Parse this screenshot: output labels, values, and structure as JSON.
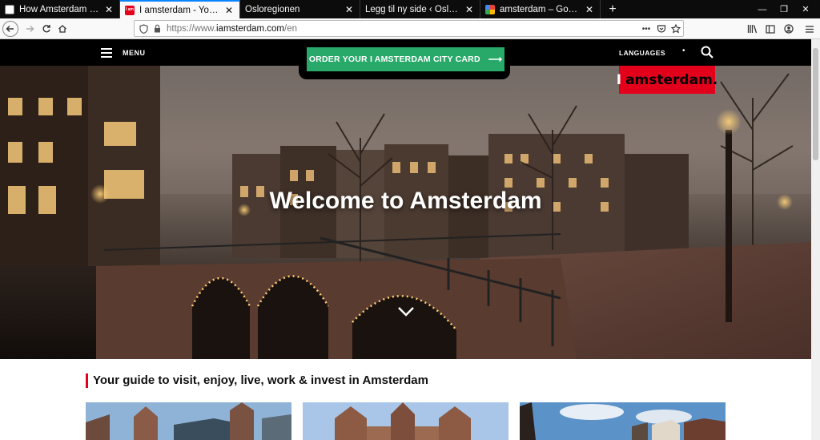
{
  "browser": {
    "tabs": [
      {
        "title": "How Amsterdam is fighting m"
      },
      {
        "title": "I amsterdam - Your guide to vis"
      },
      {
        "title": "Osloregionen"
      },
      {
        "title": "Legg til ny side ‹ Osloregionen — W"
      },
      {
        "title": "amsterdam – Google Søk"
      }
    ],
    "new_tab_symbol": "+",
    "close_symbol": "✕",
    "url": {
      "protocol": "https://www.",
      "host": "iamsterdam.com",
      "path": "/en"
    },
    "page_actions_symbol": "•••"
  },
  "site": {
    "menu_label": "MENU",
    "cta_label": "ORDER YOUR I AMSTERDAM CITY CARD",
    "cta_arrow": "⟶",
    "languages_label": "LANGUAGES",
    "languages_dot": "•",
    "logo_i": "I",
    "logo_text": "amsterdam.",
    "hero_title": "Welcome to Amsterdam",
    "section_title": "Your guide to visit, enjoy, live, work & invest in Amsterdam"
  },
  "colors": {
    "accent_green": "#28a96a",
    "brand_red": "#e3001b",
    "active_tab_indicator": "#0a84ff"
  }
}
